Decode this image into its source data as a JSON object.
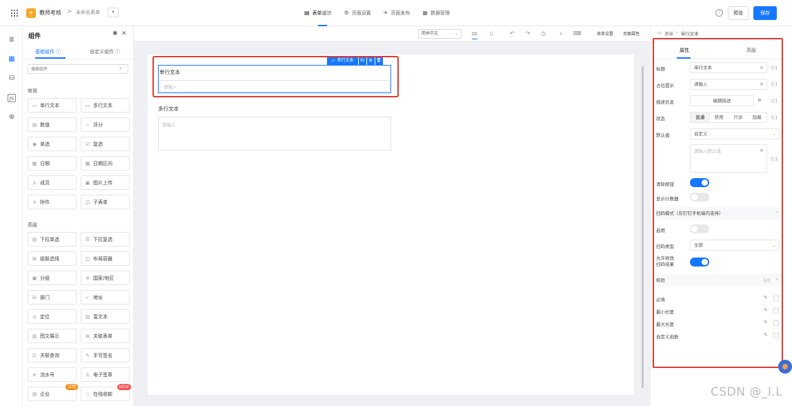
{
  "topbar": {
    "app_name": "教师考核",
    "breadcrumb_sep": ">",
    "form_name": "未命名表单",
    "tabs": [
      {
        "label": "表单设计",
        "icon": "form-icon"
      },
      {
        "label": "页面设置",
        "icon": "settings-icon"
      },
      {
        "label": "页面发布",
        "icon": "send-icon"
      },
      {
        "label": "数据管理",
        "icon": "grid-icon"
      }
    ],
    "preview_label": "预览",
    "save_label": "保存"
  },
  "components_panel": {
    "title": "组件",
    "tab_basic": "基础组件",
    "tab_custom": "自定义组件",
    "search_placeholder": "搜索组件",
    "section_common": "常用",
    "section_advanced": "高级",
    "common": [
      {
        "label": "单行文本",
        "icon": "single-line-icon"
      },
      {
        "label": "多行文本",
        "icon": "multi-line-icon"
      },
      {
        "label": "数值",
        "icon": "number-icon"
      },
      {
        "label": "评分",
        "icon": "star-icon"
      },
      {
        "label": "单选",
        "icon": "radio-icon"
      },
      {
        "label": "复选",
        "icon": "checkbox-icon"
      },
      {
        "label": "日期",
        "icon": "date-icon"
      },
      {
        "label": "日期区间",
        "icon": "date-range-icon"
      },
      {
        "label": "成员",
        "icon": "member-icon"
      },
      {
        "label": "图片上传",
        "icon": "image-upload-icon"
      },
      {
        "label": "附件",
        "icon": "attachment-icon"
      },
      {
        "label": "子表单",
        "icon": "subform-icon"
      }
    ],
    "advanced": [
      {
        "label": "下拉单选",
        "icon": "dropdown-single-icon"
      },
      {
        "label": "下拉复选",
        "icon": "dropdown-multi-icon"
      },
      {
        "label": "级联选择",
        "icon": "cascade-icon"
      },
      {
        "label": "布局容器",
        "icon": "layout-icon"
      },
      {
        "label": "分组",
        "icon": "group-icon"
      },
      {
        "label": "国家/地区",
        "icon": "region-icon"
      },
      {
        "label": "部门",
        "icon": "department-icon"
      },
      {
        "label": "地址",
        "icon": "address-icon"
      },
      {
        "label": "定位",
        "icon": "location-icon"
      },
      {
        "label": "富文本",
        "icon": "richtext-icon"
      },
      {
        "label": "图文展示",
        "icon": "media-icon"
      },
      {
        "label": "关联表单",
        "icon": "link-form-icon"
      },
      {
        "label": "关联查询",
        "icon": "link-query-icon"
      },
      {
        "label": "手写签名",
        "icon": "signature-icon"
      },
      {
        "label": "流水号",
        "icon": "serial-icon"
      },
      {
        "label": "电子签章",
        "icon": "seal-icon"
      },
      {
        "label": "企业",
        "icon": "company-icon",
        "badge": "试用"
      },
      {
        "label": "在线收款",
        "icon": "payment-icon",
        "badge": "NEW"
      }
    ]
  },
  "canvas_toolbar": {
    "font": "简体中文",
    "form_settings": "表单设置",
    "page_props": "页面属性"
  },
  "canvas": {
    "selected_chip": "单行文本",
    "field1_label": "单行文本",
    "field1_placeholder": "请输入",
    "field2_label": "多行文本",
    "field2_placeholder": "请输入"
  },
  "properties": {
    "crumb_root": "表单",
    "crumb_cur": "单行文本",
    "tab_props": "属性",
    "tab_advanced": "高级",
    "title_label": "标题",
    "title_value": "单行文本",
    "placeholder_label": "占位提示",
    "placeholder_value": "请输入",
    "desc_label": "描述信息",
    "desc_button": "编辑描述",
    "state_label": "状态",
    "state_options": [
      "普通",
      "禁用",
      "只读",
      "隐藏"
    ],
    "default_label": "默认值",
    "default_value": "自定义",
    "default_placeholder": "请输入默认值",
    "clear_label": "清除按钮",
    "clear_on": true,
    "count_label": "显示计数器",
    "count_on": false,
    "scan_section": "扫码模式（仅钉钉手机端内支持）",
    "enable_label": "启用",
    "enable_on": false,
    "scan_type_label": "扫码类型",
    "scan_type_value": "全部",
    "allow_edit_label_1": "允许修改",
    "allow_edit_label_2": "扫码结果",
    "allow_edit_on": true,
    "validate_section": "校验",
    "fx": "{/}",
    "rules": [
      "必填",
      "最小长度",
      "最大长度",
      "自定义函数"
    ]
  },
  "watermark": "CSDN @_I.L"
}
